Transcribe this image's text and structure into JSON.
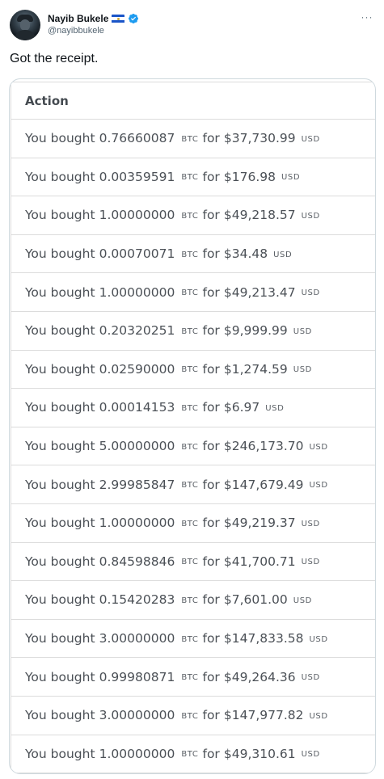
{
  "tweet": {
    "author": {
      "display_name": "Nayib Bukele",
      "handle": "@nayibbukele",
      "flag_icon": "el-salvador-flag-icon",
      "verified_icon": "verified-badge-icon",
      "verified_color": "#1d9bf0"
    },
    "more_label": "···",
    "text": "Got the receipt."
  },
  "receipt": {
    "header": "Action",
    "rows": [
      {
        "prefix": "You bought",
        "amount": "0.76660087",
        "asset": "BTC",
        "for": "for",
        "price": "$37,730.99",
        "currency": "USD"
      },
      {
        "prefix": "You bought",
        "amount": "0.00359591",
        "asset": "BTC",
        "for": "for",
        "price": "$176.98",
        "currency": "USD"
      },
      {
        "prefix": "You bought",
        "amount": "1.00000000",
        "asset": "BTC",
        "for": "for",
        "price": "$49,218.57",
        "currency": "USD"
      },
      {
        "prefix": "You bought",
        "amount": "0.00070071",
        "asset": "BTC",
        "for": "for",
        "price": "$34.48",
        "currency": "USD"
      },
      {
        "prefix": "You bought",
        "amount": "1.00000000",
        "asset": "BTC",
        "for": "for",
        "price": "$49,213.47",
        "currency": "USD"
      },
      {
        "prefix": "You bought",
        "amount": "0.20320251",
        "asset": "BTC",
        "for": "for",
        "price": "$9,999.99",
        "currency": "USD"
      },
      {
        "prefix": "You bought",
        "amount": "0.02590000",
        "asset": "BTC",
        "for": "for",
        "price": "$1,274.59",
        "currency": "USD"
      },
      {
        "prefix": "You bought",
        "amount": "0.00014153",
        "asset": "BTC",
        "for": "for",
        "price": "$6.97",
        "currency": "USD"
      },
      {
        "prefix": "You bought",
        "amount": "5.00000000",
        "asset": "BTC",
        "for": "for",
        "price": "$246,173.70",
        "currency": "USD"
      },
      {
        "prefix": "You bought",
        "amount": "2.99985847",
        "asset": "BTC",
        "for": "for",
        "price": "$147,679.49",
        "currency": "USD"
      },
      {
        "prefix": "You bought",
        "amount": "1.00000000",
        "asset": "BTC",
        "for": "for",
        "price": "$49,219.37",
        "currency": "USD"
      },
      {
        "prefix": "You bought",
        "amount": "0.84598846",
        "asset": "BTC",
        "for": "for",
        "price": "$41,700.71",
        "currency": "USD"
      },
      {
        "prefix": "You bought",
        "amount": "0.15420283",
        "asset": "BTC",
        "for": "for",
        "price": "$7,601.00",
        "currency": "USD"
      },
      {
        "prefix": "You bought",
        "amount": "3.00000000",
        "asset": "BTC",
        "for": "for",
        "price": "$147,833.58",
        "currency": "USD"
      },
      {
        "prefix": "You bought",
        "amount": "0.99980871",
        "asset": "BTC",
        "for": "for",
        "price": "$49,264.36",
        "currency": "USD"
      },
      {
        "prefix": "You bought",
        "amount": "3.00000000",
        "asset": "BTC",
        "for": "for",
        "price": "$147,977.82",
        "currency": "USD"
      },
      {
        "prefix": "You bought",
        "amount": "1.00000000",
        "asset": "BTC",
        "for": "for",
        "price": "$49,310.61",
        "currency": "USD"
      }
    ]
  }
}
